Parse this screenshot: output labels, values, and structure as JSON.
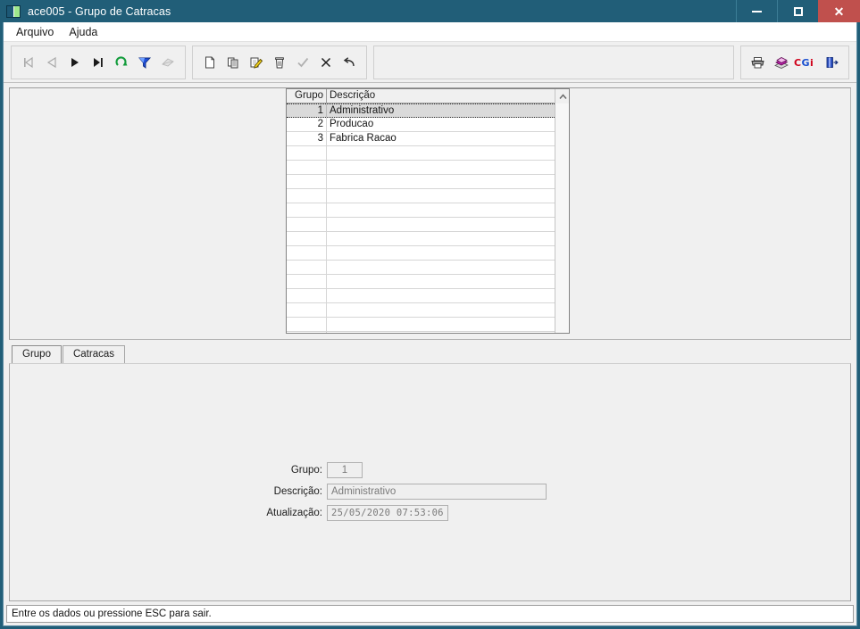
{
  "window": {
    "title": "ace005 - Grupo de Catracas",
    "icon": "app-icon",
    "controls": {
      "minimize": "minimize-button",
      "maximize": "maximize-button",
      "close": "✕"
    }
  },
  "menubar": {
    "items": [
      {
        "label": "Arquivo",
        "name": "menu-arquivo"
      },
      {
        "label": "Ajuda",
        "name": "menu-ajuda"
      }
    ]
  },
  "toolbar": {
    "groups": [
      {
        "name": "navigation-group",
        "buttons": [
          {
            "name": "first-record-button",
            "icon": "first-record-icon",
            "disabled": true
          },
          {
            "name": "previous-record-button",
            "icon": "previous-record-icon",
            "disabled": true
          },
          {
            "name": "next-record-button",
            "icon": "next-record-icon",
            "disabled": false
          },
          {
            "name": "last-record-button",
            "icon": "last-record-icon",
            "disabled": false
          },
          {
            "name": "refresh-button",
            "icon": "refresh-icon",
            "disabled": false
          },
          {
            "name": "filter-button",
            "icon": "filter-funnel-icon",
            "disabled": false
          },
          {
            "name": "clear-filter-button",
            "icon": "clear-filter-icon",
            "disabled": true
          }
        ]
      },
      {
        "name": "record-actions-group",
        "buttons": [
          {
            "name": "new-record-button",
            "icon": "new-document-icon",
            "disabled": false
          },
          {
            "name": "copy-record-button",
            "icon": "copy-icon",
            "disabled": false
          },
          {
            "name": "edit-record-button",
            "icon": "edit-pencil-icon",
            "disabled": false
          },
          {
            "name": "delete-record-button",
            "icon": "trash-icon",
            "disabled": false
          },
          {
            "name": "confirm-button",
            "icon": "checkmark-icon",
            "disabled": true
          },
          {
            "name": "cancel-button",
            "icon": "close-x-icon",
            "disabled": false
          },
          {
            "name": "undo-button",
            "icon": "undo-arrow-icon",
            "disabled": false
          }
        ]
      },
      {
        "name": "utility-group",
        "buttons": [
          {
            "name": "print-button",
            "icon": "printer-icon",
            "disabled": false
          },
          {
            "name": "help-book-button",
            "icon": "book-icon",
            "disabled": false
          },
          {
            "name": "cgi-logo-button",
            "icon": "cgi-logo-icon",
            "label": "CGi",
            "disabled": false
          },
          {
            "name": "exit-button",
            "icon": "exit-door-icon",
            "disabled": false
          }
        ]
      }
    ]
  },
  "grid": {
    "columns": [
      {
        "key": "grupo",
        "label": "Grupo"
      },
      {
        "key": "descricao",
        "label": "Descrição"
      }
    ],
    "rows": [
      {
        "grupo": "1",
        "descricao": "Administrativo",
        "selected": true
      },
      {
        "grupo": "2",
        "descricao": "Producao",
        "selected": false
      },
      {
        "grupo": "3",
        "descricao": "Fabrica Racao",
        "selected": false
      }
    ],
    "empty_row_count": 15,
    "scrollbar": {
      "up_arrow": "scroll-up-icon",
      "down_arrow": "scroll-down-icon"
    }
  },
  "tabs": [
    {
      "label": "Grupo",
      "name": "tab-grupo",
      "active": true
    },
    {
      "label": "Catracas",
      "name": "tab-catracas",
      "active": false
    }
  ],
  "form": {
    "fields": [
      {
        "label": "Grupo:",
        "value": "1",
        "name": "grupo-field"
      },
      {
        "label": "Descrição:",
        "value": "Administrativo",
        "name": "descricao-field"
      },
      {
        "label": "Atualização:",
        "value": "25/05/2020 07:53:06",
        "name": "atualizacao-field"
      }
    ]
  },
  "statusbar": {
    "message": "Entre os dados ou pressione ESC para sair."
  },
  "colors": {
    "titlebar": "#215e78",
    "close_button": "#c0504d",
    "client_background": "#f0f0f0",
    "grid_background": "#ffffff",
    "selected_row": "#dadada"
  }
}
